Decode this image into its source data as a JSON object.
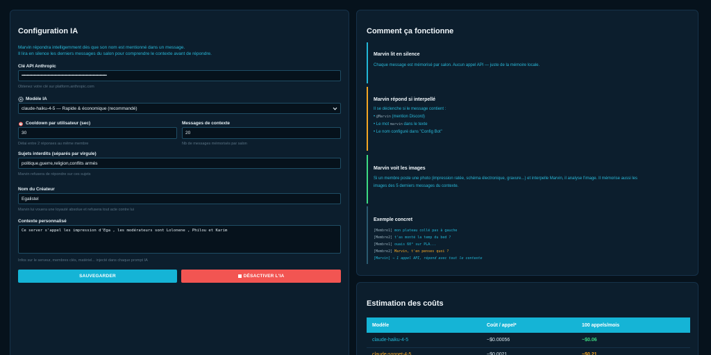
{
  "config": {
    "title": "Configuration IA",
    "intro_line1": "Marvin répondra intelligemment dès que son nom est mentionné dans un message.",
    "intro_line2": "Il lira en silence les derniers messages du salon pour comprendre le contexte avant de répondre.",
    "api_key": {
      "label": "Clé API Anthropic",
      "value": "••••••••••••••••••••••••••••••••••••••••••••••••••••••••••••••••••••••••••••••••••••••••••••••••••",
      "help": "Obtenez votre clé sur platform.anthropic.com"
    },
    "model": {
      "label": "Modèle IA",
      "icon": "gear-icon",
      "value": "claude-haiku-4-5 — Rapide & économique (recommandé)"
    },
    "cooldown": {
      "label": "Cooldown par utilisateur (sec)",
      "icon": "alarm-clock-icon",
      "value": "30",
      "help": "Délai entre 2 réponses au même membre"
    },
    "context_messages": {
      "label": "Messages de contexte",
      "value": "20",
      "help": "Nb de messages mémorisés par salon"
    },
    "forbidden_topics": {
      "label": "Sujets interdits (séparés par virgule)",
      "value": "politique,guerre,religion,conflits armés",
      "help": "Marvin refusera de répondre sur ces sujets"
    },
    "creator": {
      "label": "Nom du Créateur",
      "value": "Egalistel",
      "help": "Marvin lui vouera une loyauté absolue et refusera tout acte contre lui"
    },
    "custom_context": {
      "label": "Contexte personnalisé",
      "value": "Ce server s'appel les impression d'Ega , les modérateurs sont Lolonene , Philou et Karim",
      "help": "Infos sur le serveur, membres clés, matériel... injecté dans chaque prompt IA"
    },
    "save_label": "SAUVEGARDER",
    "deactivate_label": "DÉSACTIVER L'IA"
  },
  "how": {
    "title": "Comment ça fonctionne",
    "step1": {
      "title": "Marvin lit en silence",
      "text": "Chaque message est mémorisé par salon. Aucun appel API — juste de la mémoire locale."
    },
    "step2": {
      "title": "Marvin répond si interpellé",
      "intro": "Il se déclenche si le message contient :",
      "b1_code": "@Marvin",
      "b1_text": "(mention Discord)",
      "b2_pre": "Le mot",
      "b2_code": "marvin",
      "b2_post": "dans le texte",
      "b3_text": "Le nom configuré dans \"Config Bot\""
    },
    "step3": {
      "title": "Marvin voit les images",
      "text1": "Si un membre poste une photo (impression ratée, schéma électronique, gravure...) et interpelle Marvin, il analyse l'image. Il mémorise aussi les",
      "text2": "images des 5 derniers messages du contexte."
    },
    "step4": {
      "title": "Exemple concret",
      "lines": [
        {
          "user": "[Membre1]",
          "msg": "mon plateau collé pas à gauche"
        },
        {
          "user": "[Membre2]",
          "msg": "t'as monté la temp du bed ?"
        },
        {
          "user": "[Membre1]",
          "msg": "ouais 60° sur PLA..."
        },
        {
          "user": "[Membre2]",
          "msg": "Marvin, t'en penses quoi ?"
        },
        {
          "user": "[Marvin]",
          "msg": "→ 1 appel API, répond avec tout le contexte"
        }
      ]
    }
  },
  "cost": {
    "title": "Estimation des coûts",
    "headers": [
      "Modèle",
      "Coût / appel*",
      "100 appels/mois"
    ],
    "rows": [
      {
        "model": "claude-haiku-4-5",
        "cost": "~$0.00056",
        "monthly": "~$0.06",
        "color": "#22b8d8"
      },
      {
        "model": "claude-sonnet-4-5",
        "cost": "~$0.0021",
        "monthly": "~$0.21",
        "color": "#f5a623"
      }
    ]
  },
  "colors": {
    "accent": "#15b4d6",
    "danger": "#f25552",
    "orange": "#f5a623",
    "green": "#3ddc84"
  }
}
